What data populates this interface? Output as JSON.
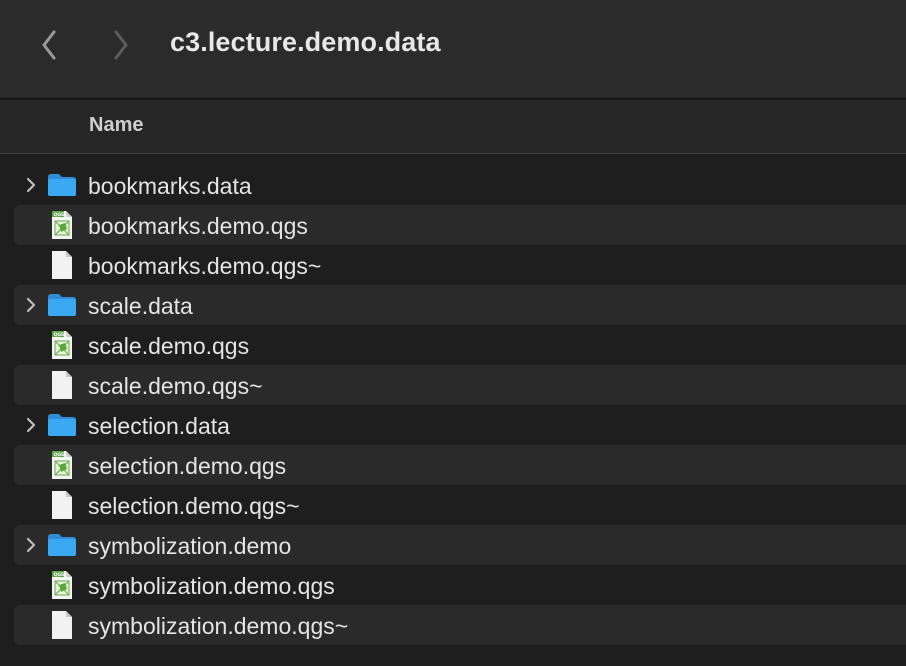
{
  "window": {
    "title": "c3.lecture.demo.data"
  },
  "toolbar": {
    "back_icon": "chevron-left-icon",
    "forward_icon": "chevron-right-icon"
  },
  "columns": {
    "name_label": "Name"
  },
  "files": [
    {
      "name": "bookmarks.data",
      "kind": "folder"
    },
    {
      "name": "bookmarks.demo.qgs",
      "kind": "qgs"
    },
    {
      "name": "bookmarks.demo.qgs~",
      "kind": "document"
    },
    {
      "name": "scale.data",
      "kind": "folder"
    },
    {
      "name": "scale.demo.qgs",
      "kind": "qgs"
    },
    {
      "name": "scale.demo.qgs~",
      "kind": "document"
    },
    {
      "name": "selection.data",
      "kind": "folder"
    },
    {
      "name": "selection.demo.qgs",
      "kind": "qgs"
    },
    {
      "name": "selection.demo.qgs~",
      "kind": "document"
    },
    {
      "name": "symbolization.demo",
      "kind": "folder"
    },
    {
      "name": "symbolization.demo.qgs",
      "kind": "qgs"
    },
    {
      "name": "symbolization.demo.qgs~",
      "kind": "document"
    }
  ],
  "colors": {
    "folder": "#3ba9f2",
    "qgs_green": "#5aa83a",
    "background": "#1e1e1e",
    "stripe": "#2a2a2a"
  }
}
